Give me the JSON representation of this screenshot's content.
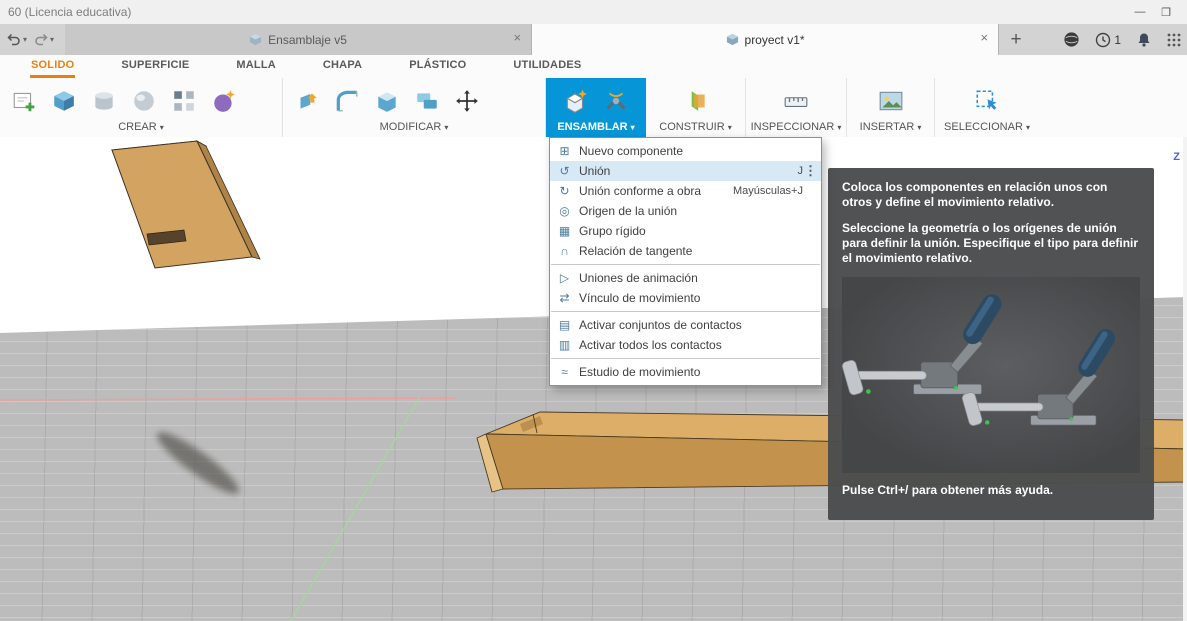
{
  "window": {
    "title": "60 (Licencia educativa)",
    "minimize_glyph": "—",
    "maximize_glyph": "❐"
  },
  "navbar": {
    "undo_caret": "▾",
    "redo_caret": "▾",
    "tabs": [
      {
        "label": "Ensamblaje v5",
        "close_glyph": "×",
        "active": false
      },
      {
        "label": "proyect v1*",
        "close_glyph": "×",
        "active": true
      }
    ],
    "new_tab_glyph": "+",
    "job_count": "1"
  },
  "ribbon": {
    "tabs": [
      {
        "label": "SOLIDO",
        "active": true
      },
      {
        "label": "SUPERFICIE"
      },
      {
        "label": "MALLA"
      },
      {
        "label": "CHAPA"
      },
      {
        "label": "PLÁSTICO"
      },
      {
        "label": "UTILIDADES"
      }
    ],
    "groups": [
      {
        "label": "CREAR",
        "caret": "▾",
        "icons": [
          "create-sketch-icon",
          "box-icon",
          "cylinder-icon",
          "sphere-icon",
          "pattern-icon",
          "form-icon"
        ]
      },
      {
        "label": "MODIFICAR",
        "caret": "▾",
        "icons": [
          "press-pull-icon",
          "fillet-icon",
          "shell-icon",
          "combine-icon",
          "move-copy-icon"
        ]
      },
      {
        "label": "ENSAMBLAR",
        "caret": "▾",
        "accent": "#0696d7",
        "icons": [
          "new-component-icon",
          "joint-icon"
        ]
      },
      {
        "label": "CONSTRUIR",
        "caret": "▾",
        "icons": [
          "construction-plane-icon"
        ]
      },
      {
        "label": "INSPECCIONAR",
        "caret": "▾",
        "icons": [
          "measure-icon"
        ]
      },
      {
        "label": "INSERTAR",
        "caret": "▾",
        "icons": [
          "insert-image-icon"
        ]
      },
      {
        "label": "SELECCIONAR",
        "caret": "▾",
        "icons": [
          "select-icon"
        ]
      }
    ]
  },
  "menu": {
    "items": [
      {
        "label": "Nuevo componente",
        "icon": "new-component-icon",
        "glyph": "⊞"
      },
      {
        "label": "Unión",
        "shortcut": "J",
        "icon": "joint-icon",
        "glyph": "↺",
        "highlighted": true,
        "more_glyph": "⋮"
      },
      {
        "label": "Unión conforme a obra",
        "shortcut": "Mayúsculas+J",
        "icon": "as-built-joint-icon",
        "glyph": "↻"
      },
      {
        "label": "Origen de la unión",
        "icon": "joint-origin-icon",
        "glyph": "◎"
      },
      {
        "label": "Grupo rígido",
        "icon": "rigid-group-icon",
        "glyph": "▦"
      },
      {
        "label": "Relación de tangente",
        "icon": "tangent-relation-icon",
        "glyph": "∩"
      },
      {
        "label": "Uniones de animación",
        "icon": "animate-joints-icon",
        "glyph": "▷"
      },
      {
        "label": "Vínculo de movimiento",
        "icon": "motion-link-icon",
        "glyph": "⇄"
      },
      {
        "label": "Activar conjuntos de contactos",
        "icon": "contact-sets-icon",
        "glyph": "▤"
      },
      {
        "label": "Activar todos los contactos",
        "icon": "all-contacts-icon",
        "glyph": "▥"
      },
      {
        "label": "Estudio de movimiento",
        "icon": "motion-study-icon",
        "glyph": "≈"
      }
    ]
  },
  "tooltip": {
    "title_paragraph": "Coloca los componentes en relación unos con otros y define el movimiento relativo.",
    "body_paragraph": "Seleccione la geometría o los orígenes de unión para definir la unión. Especifique el tipo para definir el movimiento relativo.",
    "footer": "Pulse Ctrl+/ para obtener más ayuda."
  },
  "viewport": {
    "z_axis_label": "Z"
  }
}
